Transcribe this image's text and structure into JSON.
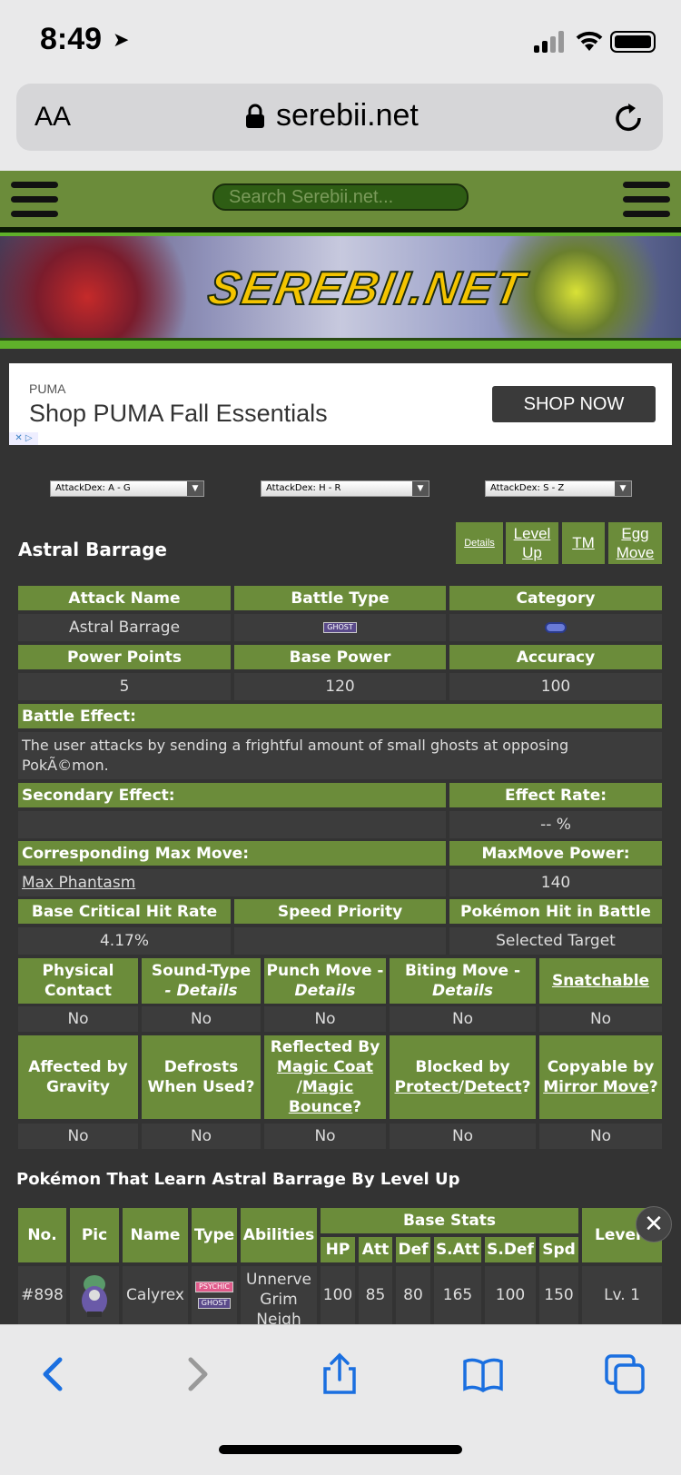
{
  "status": {
    "time": "8:49"
  },
  "browser": {
    "aa_label": "AA",
    "host": "serebii.net"
  },
  "site": {
    "search_placeholder": "Search Serebii.net...",
    "logo": "SEREBII.NET"
  },
  "ad": {
    "brand": "PUMA",
    "tagline": "Shop PUMA Fall Essentials",
    "cta": "SHOP NOW"
  },
  "dropdowns": [
    "AttackDex: A - G",
    "AttackDex: H - R",
    "AttackDex: S - Z"
  ],
  "move": {
    "title": "Astral Barrage",
    "links": [
      "Details",
      "Level Up",
      "TM",
      "Egg Move"
    ],
    "headers1": [
      "Attack Name",
      "Battle Type",
      "Category"
    ],
    "name": "Astral Barrage",
    "type_badge": "GHOST",
    "headers2": [
      "Power Points",
      "Base Power",
      "Accuracy"
    ],
    "pp": "5",
    "power": "120",
    "accuracy": "100",
    "battle_effect_label": "Battle Effect:",
    "battle_effect": "The user attacks by sending a frightful amount of small ghosts at opposing PokÃ©mon.",
    "secondary_label": "Secondary Effect:",
    "effect_rate_label": "Effect Rate:",
    "effect_rate": "-- %",
    "max_move_label": "Corresponding Max Move:",
    "max_power_label": "MaxMove Power:",
    "max_move": "Max Phantasm",
    "max_power": "140",
    "headers3": [
      "Base Critical Hit Rate",
      "Speed Priority",
      "Pokémon Hit in Battle"
    ],
    "crit": "4.17%",
    "priority": "",
    "target": "Selected Target",
    "flags1": {
      "physical": "Physical Contact",
      "sound": "Sound-Type",
      "sound_details": "- Details",
      "punch": "Punch Move -",
      "punch_details": "Details",
      "biting": "Biting Move -",
      "biting_details": "Details",
      "snatch": "Snatchable"
    },
    "flags1_values": [
      "No",
      "No",
      "No",
      "No",
      "No"
    ],
    "flags2": {
      "gravity": "Affected by Gravity",
      "defrost": "Defrosts When Used?",
      "reflected_prefix": "Reflected By",
      "magic_coat": "Magic Coat",
      "magic_bounce": "Bounce",
      "magic_word": "Magic",
      "blocked": "Blocked by",
      "protect": "Protect",
      "detect": "Detect",
      "copy": "Copyable by",
      "mirror": "Mirror Move"
    },
    "flags2_values": [
      "No",
      "No",
      "No",
      "No",
      "No"
    ]
  },
  "levelup": {
    "title": "Pokémon That Learn Astral Barrage By Level Up",
    "headers": [
      "No.",
      "Pic",
      "Name",
      "Type",
      "Abilities",
      "Base Stats",
      "Level"
    ],
    "stat_headers": [
      "HP",
      "Att",
      "Def",
      "S.Att",
      "S.Def",
      "Spd"
    ],
    "rows": [
      {
        "no": "#898",
        "name": "Calyrex",
        "types": [
          "PSYCHIC",
          "GHOST"
        ],
        "abilities": "Unnerve Grim Neigh",
        "stats": [
          "100",
          "85",
          "80",
          "165",
          "100",
          "150"
        ],
        "level": "Lv. 1"
      }
    ]
  }
}
